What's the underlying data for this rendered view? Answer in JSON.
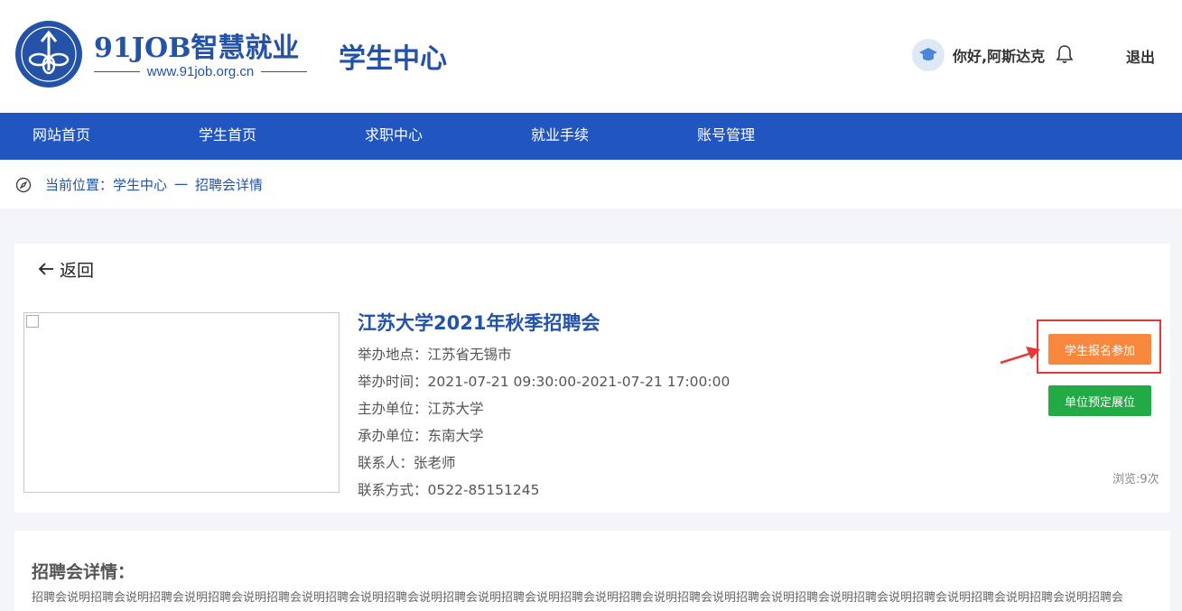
{
  "header": {
    "logo_cn": "91JOB智慧就业",
    "logo_url": "www.91job.org.cn",
    "center_title": "学生中心",
    "greeting": "你好,阿斯达克",
    "logout": "退出"
  },
  "nav": {
    "items": [
      {
        "label": "网站首页"
      },
      {
        "label": "学生首页"
      },
      {
        "label": "求职中心"
      },
      {
        "label": "就业手续"
      },
      {
        "label": "账号管理"
      }
    ]
  },
  "breadcrumb": {
    "prefix": "当前位置：",
    "level1": "学生中心",
    "separator": "一",
    "level2": "招聘会详情"
  },
  "fair": {
    "back_label": "返回",
    "title": "江苏大学2021年秋季招聘会",
    "location": "举办地点：江苏省无锡市",
    "time": "举办时间：2021-07-21 09:30:00-2021-07-21 17:00:00",
    "host": "主办单位：江苏大学",
    "organizer": "承办单位：东南大学",
    "contact": "联系人：张老师",
    "phone": "联系方式：0522-85151245",
    "register_button": "学生报名参加",
    "booth_button": "单位预定展位",
    "views": "浏览:9次"
  },
  "details": {
    "title": "招聘会详情：",
    "body": "招聘会说明招聘会说明招聘会说明招聘会说明招聘会说明招聘会说明招聘会说明招聘会说明招聘会说明招聘会说明招聘会说明招聘会说明招聘会说明招聘会说明招聘会说明招聘会说明招聘会说明招聘会说明招聘会"
  },
  "colors": {
    "brand_blue": "#2155bf",
    "register_orange": "#f7883e",
    "booth_green": "#22aa44",
    "highlight_red": "#e53935"
  }
}
